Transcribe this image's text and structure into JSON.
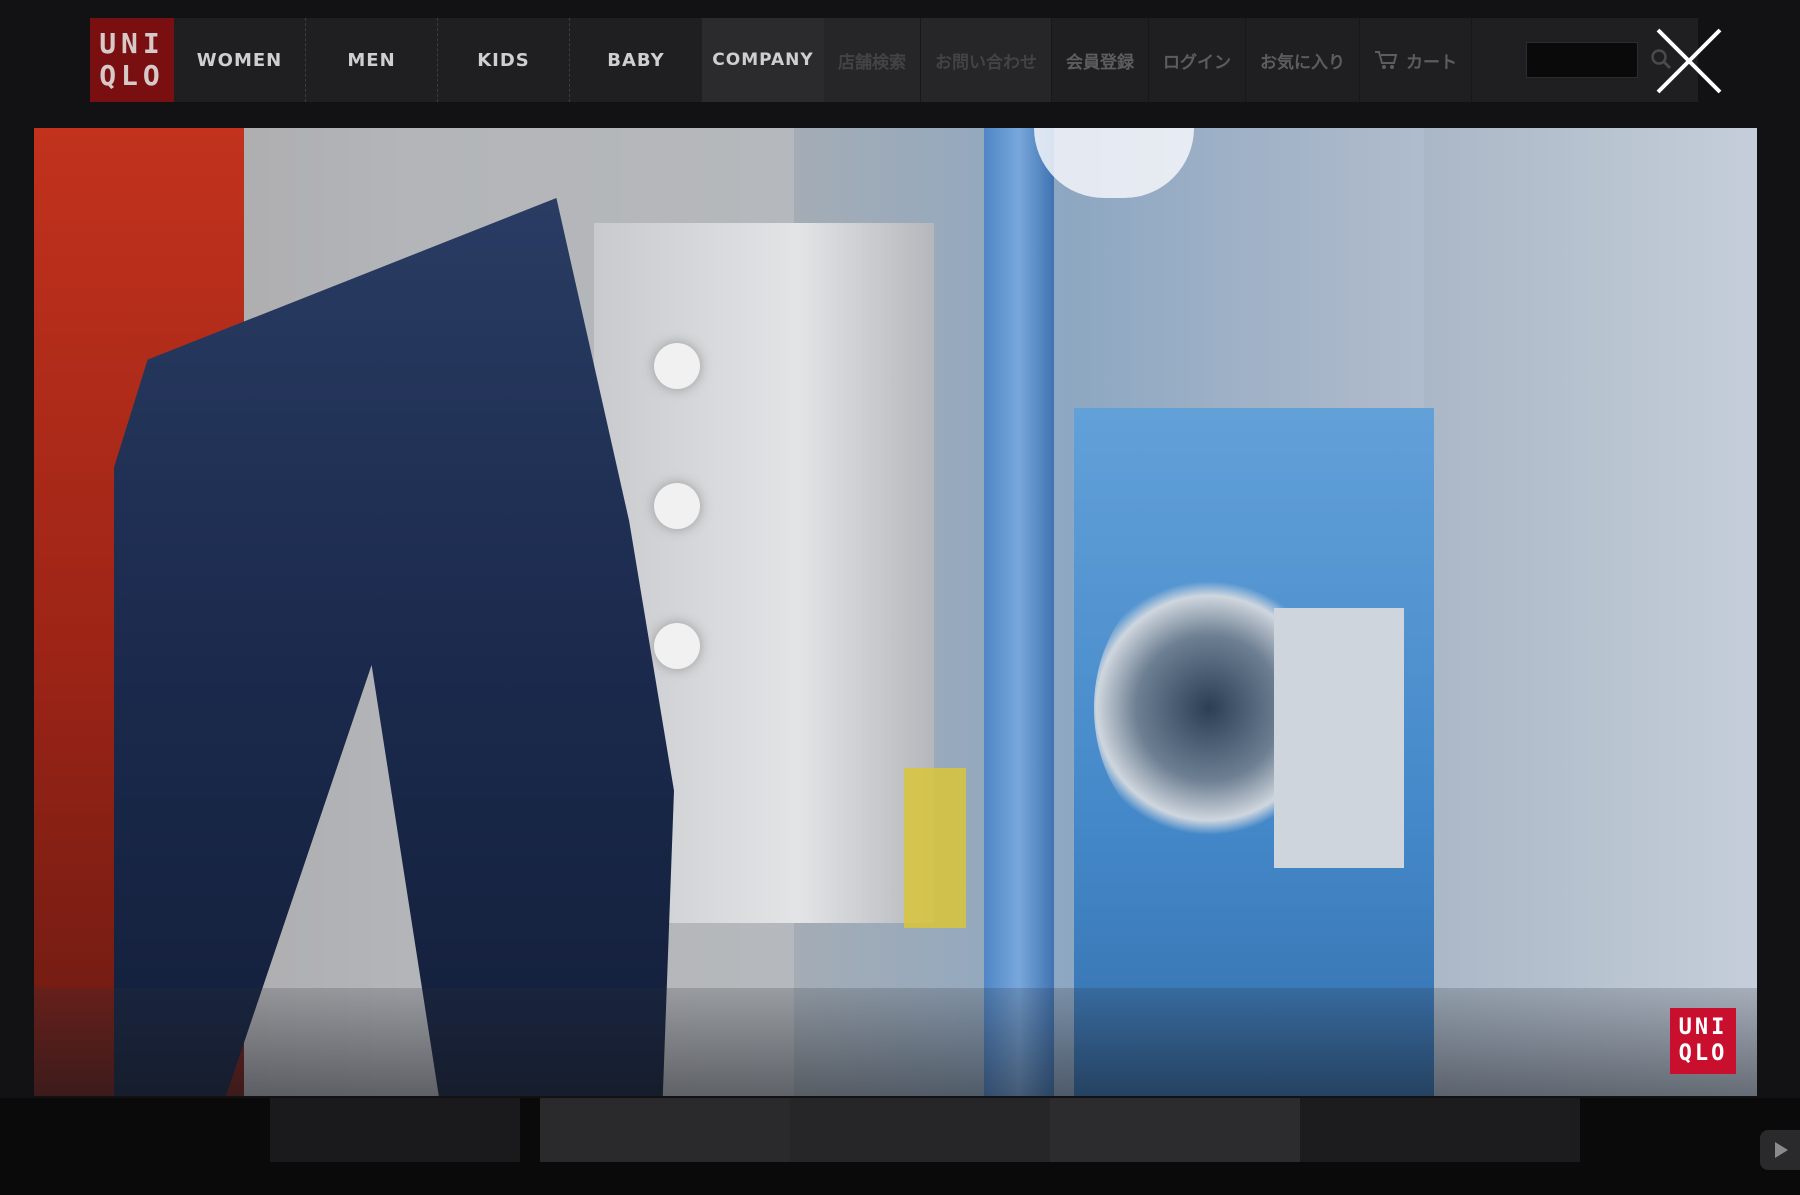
{
  "header": {
    "logo_line1": "UNI",
    "logo_line2": "QLO",
    "nav_main": [
      "WOMEN",
      "MEN",
      "KIDS",
      "BABY"
    ],
    "nav_company": "COMPANY",
    "nav_util": [
      "店舗検索",
      "お問い合わせ",
      "会員登録",
      "ログイン",
      "お気に入り"
    ],
    "cart_label": "カート",
    "search_placeholder": ""
  },
  "video": {
    "watermark_line1": "UNI",
    "watermark_line2": "QLO"
  },
  "icons": {
    "close": "close-icon",
    "cart": "cart-icon",
    "search": "search-icon",
    "play": "play-icon"
  },
  "colors": {
    "brand_red": "#c8102e",
    "header_bg": "#1f1f21"
  }
}
